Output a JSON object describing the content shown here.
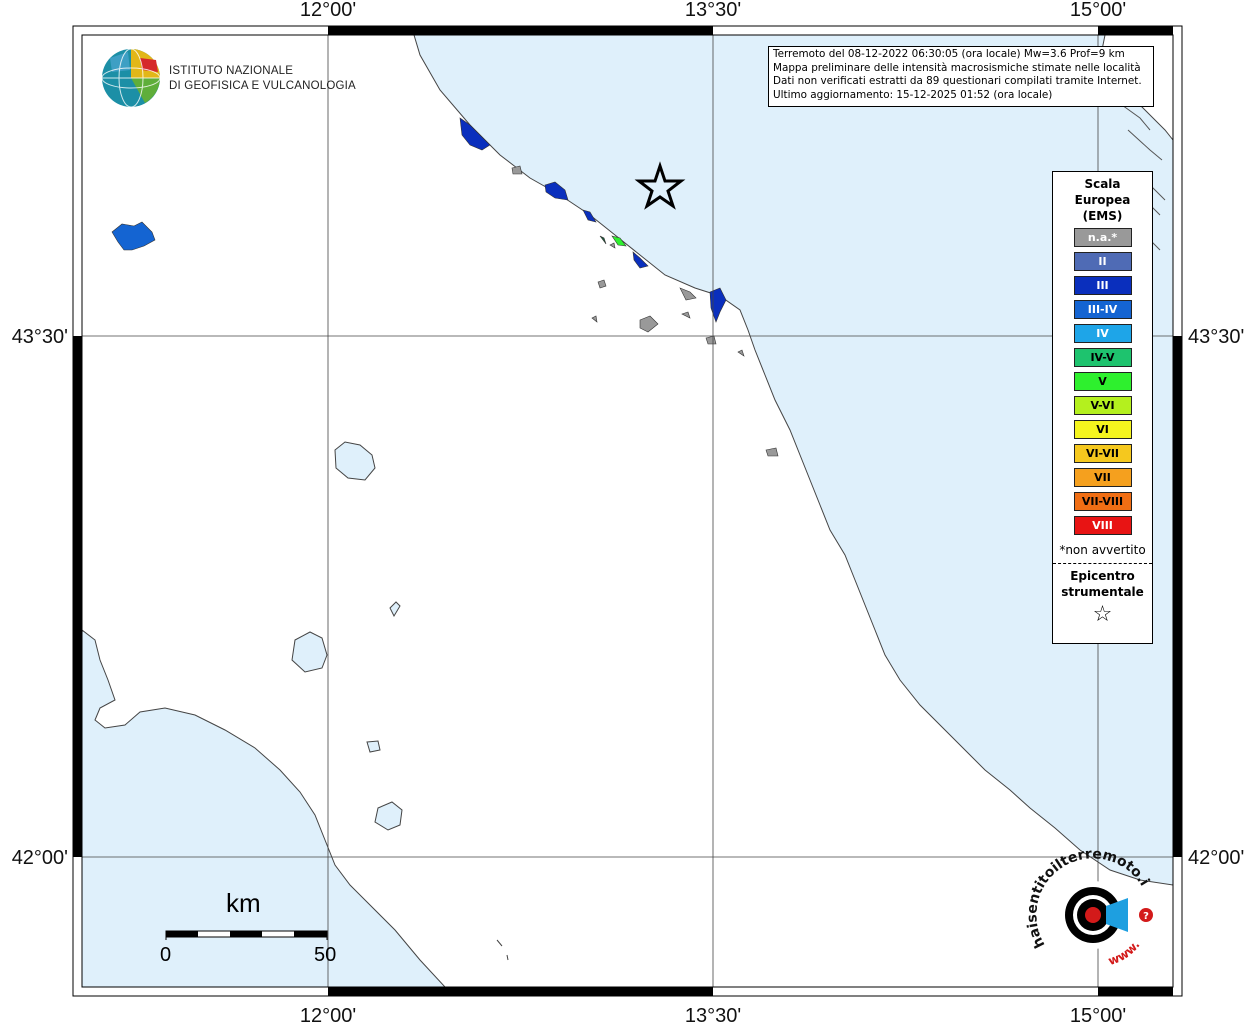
{
  "map": {
    "title_lines": [
      "Terremoto del 08-12-2022 06:30:05 (ora locale) Mw=3.6 Prof=9 km",
      "Mappa preliminare delle intensità macrosismiche stimate nelle località",
      "Dati non verificati estratti da 89 questionari compilati tramite Internet.",
      "Ultimo aggiornamento: 15-12-2025 01:52 (ora locale)"
    ],
    "lon_ticks": [
      "12°00'",
      "13°30'",
      "15°00'"
    ],
    "lat_ticks": [
      "43°30'",
      "42°00'"
    ],
    "colors": {
      "sea": "#dff0fb",
      "land": "#ffffff",
      "epicenter": "#000000"
    }
  },
  "logo": {
    "line1": "ISTITUTO NAZIONALE",
    "line2": "DI GEOFISICA E VULCANOLOGIA"
  },
  "legend": {
    "title": "Scala Europea (EMS)",
    "title_lines": [
      "Scala",
      "Europea",
      "(EMS)"
    ],
    "items": [
      {
        "label": "n.a.*",
        "color": "#999999",
        "text_color": "#ffffff"
      },
      {
        "label": "II",
        "color": "#4f6bb5",
        "text_color": "#ffffff"
      },
      {
        "label": "III",
        "color": "#0a2fbd",
        "text_color": "#ffffff"
      },
      {
        "label": "III-IV",
        "color": "#1464d2",
        "text_color": "#ffffff"
      },
      {
        "label": "IV",
        "color": "#1ea5e8",
        "text_color": "#ffffff"
      },
      {
        "label": "IV-V",
        "color": "#1ec36e",
        "text_color": "#000000"
      },
      {
        "label": "V",
        "color": "#2ef02e",
        "text_color": "#000000"
      },
      {
        "label": "V-VI",
        "color": "#b4f01e",
        "text_color": "#000000"
      },
      {
        "label": "VI",
        "color": "#f5f51e",
        "text_color": "#000000"
      },
      {
        "label": "VI-VII",
        "color": "#f5c81e",
        "text_color": "#000000"
      },
      {
        "label": "VII",
        "color": "#f5a01e",
        "text_color": "#000000"
      },
      {
        "label": "VII-VIII",
        "color": "#f06e14",
        "text_color": "#000000"
      },
      {
        "label": "VIII",
        "color": "#e81414",
        "text_color": "#ffffff"
      }
    ],
    "note": "*non avvertito",
    "epicenter_lines": [
      "Epicentro",
      "strumentale"
    ],
    "epicenter_symbol": "☆"
  },
  "scalebar": {
    "unit": "km",
    "min": "0",
    "max": "50"
  },
  "badge": {
    "text_top": "haisentitoilterremoto.it",
    "text_bottom": "www."
  }
}
